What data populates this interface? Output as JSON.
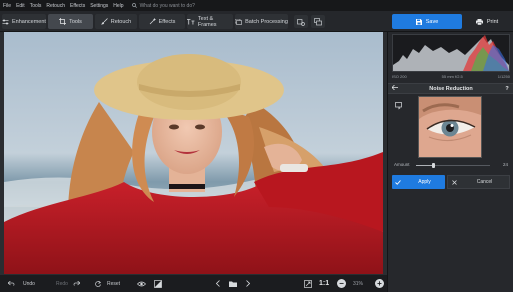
{
  "menu": [
    "File",
    "Edit",
    "Tools",
    "Retouch",
    "Effects",
    "Settings",
    "Help"
  ],
  "search": {
    "placeholder": "What do you want to do?"
  },
  "toolbar": {
    "tabs": [
      {
        "label": "Enhancement",
        "icon": "sliders-icon"
      },
      {
        "label": "Tools",
        "icon": "crop-icon"
      },
      {
        "label": "Retouch",
        "icon": "brush-icon"
      },
      {
        "label": "Effects",
        "icon": "magic-wand-icon"
      },
      {
        "label": "Text & Frames",
        "icon": "text-icon"
      },
      {
        "label": "Batch Processing",
        "icon": "batch-icon"
      }
    ],
    "active_tab": "Tools",
    "save_label": "Save",
    "print_label": "Print"
  },
  "bottom": {
    "undo_label": "Undo",
    "redo_label": "Redo",
    "reset_label": "Reset",
    "zoom_fit": "1:1",
    "zoom_level": "31%"
  },
  "panel": {
    "exif": [
      "ISO 200",
      "55 mm f/2.5",
      "1/1250"
    ],
    "title": "Noise Reduction",
    "amount_label": "Amount",
    "amount_value": "24",
    "amount_fraction": 0.24,
    "apply_label": "Apply",
    "cancel_label": "Cancel"
  },
  "colors": {
    "accent": "#1f7be0",
    "background": "#1e2023",
    "panel": "#26282c"
  }
}
